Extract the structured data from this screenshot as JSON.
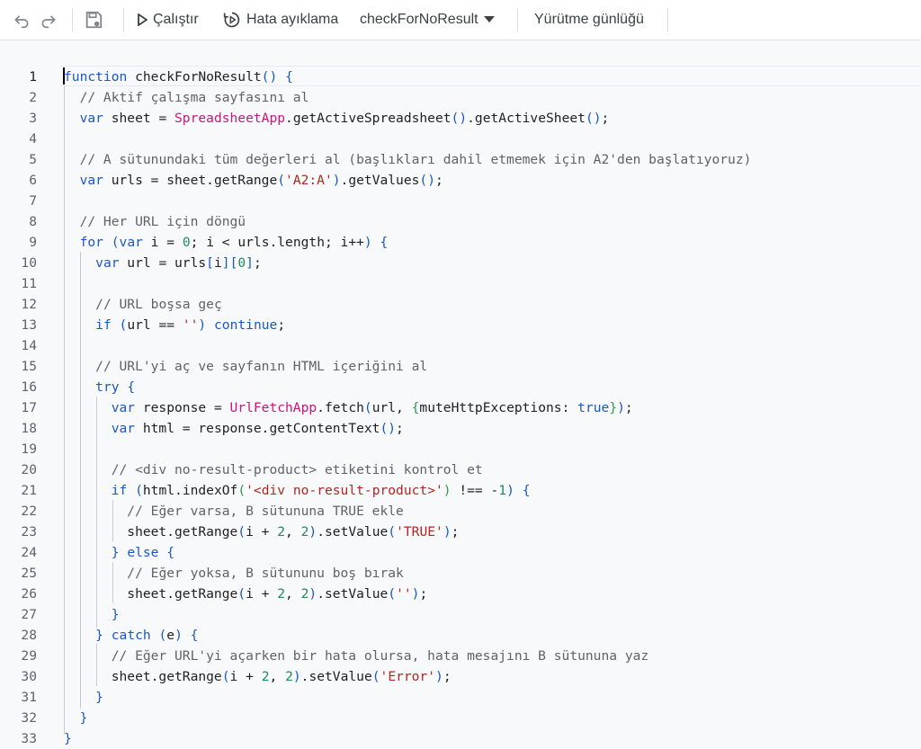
{
  "toolbar": {
    "undo_icon": "undo-icon",
    "redo_icon": "redo-icon",
    "save_icon": "save-project-icon",
    "run_label": "Çalıştır",
    "debug_label": "Hata ayıklama",
    "function_select": "checkForNoResult",
    "execution_log_label": "Yürütme günlüğü"
  },
  "editor": {
    "lines": [
      {
        "n": "1"
      },
      {
        "n": "2"
      },
      {
        "n": "3"
      },
      {
        "n": "4"
      },
      {
        "n": "5"
      },
      {
        "n": "6"
      },
      {
        "n": "7"
      },
      {
        "n": "8"
      },
      {
        "n": "9"
      },
      {
        "n": "10"
      },
      {
        "n": "11"
      },
      {
        "n": "12"
      },
      {
        "n": "13"
      },
      {
        "n": "14"
      },
      {
        "n": "15"
      },
      {
        "n": "16"
      },
      {
        "n": "17"
      },
      {
        "n": "18"
      },
      {
        "n": "19"
      },
      {
        "n": "20"
      },
      {
        "n": "21"
      },
      {
        "n": "22"
      },
      {
        "n": "23"
      },
      {
        "n": "24"
      },
      {
        "n": "25"
      },
      {
        "n": "26"
      },
      {
        "n": "27"
      },
      {
        "n": "28"
      },
      {
        "n": "29"
      },
      {
        "n": "30"
      },
      {
        "n": "31"
      },
      {
        "n": "32"
      },
      {
        "n": "33"
      }
    ],
    "code": [
      "function checkForNoResult() {",
      "  // Aktif çalışma sayfasını al",
      "  var sheet = SpreadsheetApp.getActiveSpreadsheet().getActiveSheet();",
      "",
      "  // A sütunundaki tüm değerleri al (başlıkları dahil etmemek için A2'den başlatıyoruz)",
      "  var urls = sheet.getRange('A2:A').getValues();",
      "",
      "  // Her URL için döngü",
      "  for (var i = 0; i < urls.length; i++) {",
      "    var url = urls[i][0];",
      "",
      "    // URL boşsa geç",
      "    if (url == '') continue;",
      "",
      "    // URL'yi aç ve sayfanın HTML içeriğini al",
      "    try {",
      "      var response = UrlFetchApp.fetch(url, {muteHttpExceptions: true});",
      "      var html = response.getContentText();",
      "",
      "      // <div no-result-product> etiketini kontrol et",
      "      if (html.indexOf('<div no-result-product>') !== -1) {",
      "        // Eğer varsa, B sütununa TRUE ekle",
      "        sheet.getRange(i + 2, 2).setValue('TRUE');",
      "      } else {",
      "        // Eğer yoksa, B sütununu boş bırak",
      "        sheet.getRange(i + 2, 2).setValue('');",
      "      }",
      "    } catch (e) {",
      "      // Eğer URL'yi açarken bir hata olursa, hata mesajını B sütununa yaz",
      "      sheet.getRange(i + 2, 2).setValue('Error');",
      "    }",
      "  }",
      "}"
    ]
  },
  "colors": {
    "keyword": "#1a57c7",
    "comment": "#5f6368",
    "string": "#b3261e",
    "number": "#1f8a5b",
    "class": "#c8177d"
  }
}
